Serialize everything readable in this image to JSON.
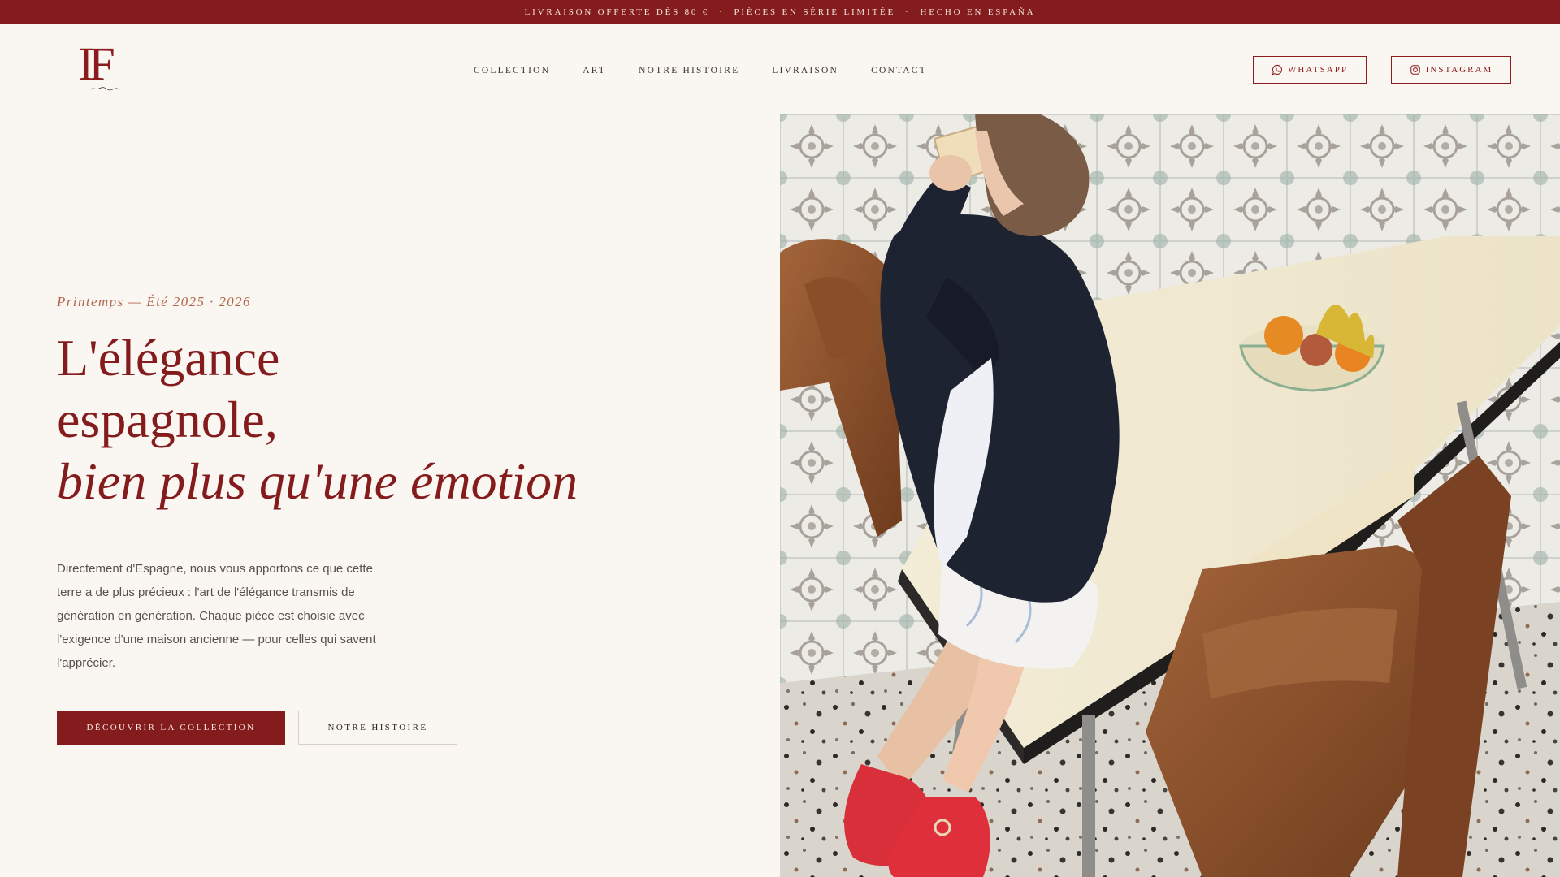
{
  "topbar": {
    "items": [
      "LIVRAISON OFFERTE DÈS 80 €",
      "PIÈCES EN SÉRIE LIMITÉE",
      "HECHO EN ESPAÑA"
    ],
    "separator": "·"
  },
  "logo": {
    "mark": "IF"
  },
  "nav": {
    "items": [
      "COLLECTION",
      "ART",
      "NOTRE HISTOIRE",
      "LIVRAISON",
      "CONTACT"
    ]
  },
  "social": {
    "whatsapp_label": "WHATSAPP",
    "instagram_label": "INSTAGRAM"
  },
  "hero": {
    "eyebrow": "Printemps — Été 2025 · 2026",
    "headline_line1": "L'élégance",
    "headline_line2": "espagnole,",
    "headline_line3": "bien plus qu'une émotion",
    "lead": "Directement d'Espagne, nous vous apportons ce que cette terre a de plus précieux : l'art de l'élégance transmis de génération en génération. Chaque pièce est choisie avec l'exigence d'une maison ancienne — pour celles qui savent l'apprécier.",
    "cta_primary": "DÉCOUVRIR LA COLLECTION",
    "cta_secondary": "NOTRE HISTOIRE"
  },
  "colors": {
    "brand": "#841b1d",
    "accent": "#b3664a",
    "background": "#faf6f1"
  },
  "icons": {
    "whatsapp": "whatsapp-icon",
    "instagram": "instagram-icon"
  }
}
